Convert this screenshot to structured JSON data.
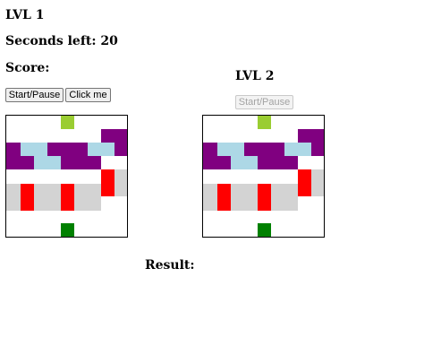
{
  "game": {
    "level1_title": "LVL 1",
    "seconds_label": "Seconds left: 20",
    "score_label": "Score:",
    "level2_title": "LVL 2",
    "result_label": "Result:"
  },
  "buttons": {
    "start_pause_label": "Start/Pause",
    "click_me_label": "Click me",
    "start_pause2_label": "Start/Pause"
  },
  "colors": {
    "goal": "#9acd32",
    "player": "#008000",
    "water": "#add8e6",
    "log": "#800080",
    "car": "#ff0000",
    "road": "#d3d3d3"
  }
}
